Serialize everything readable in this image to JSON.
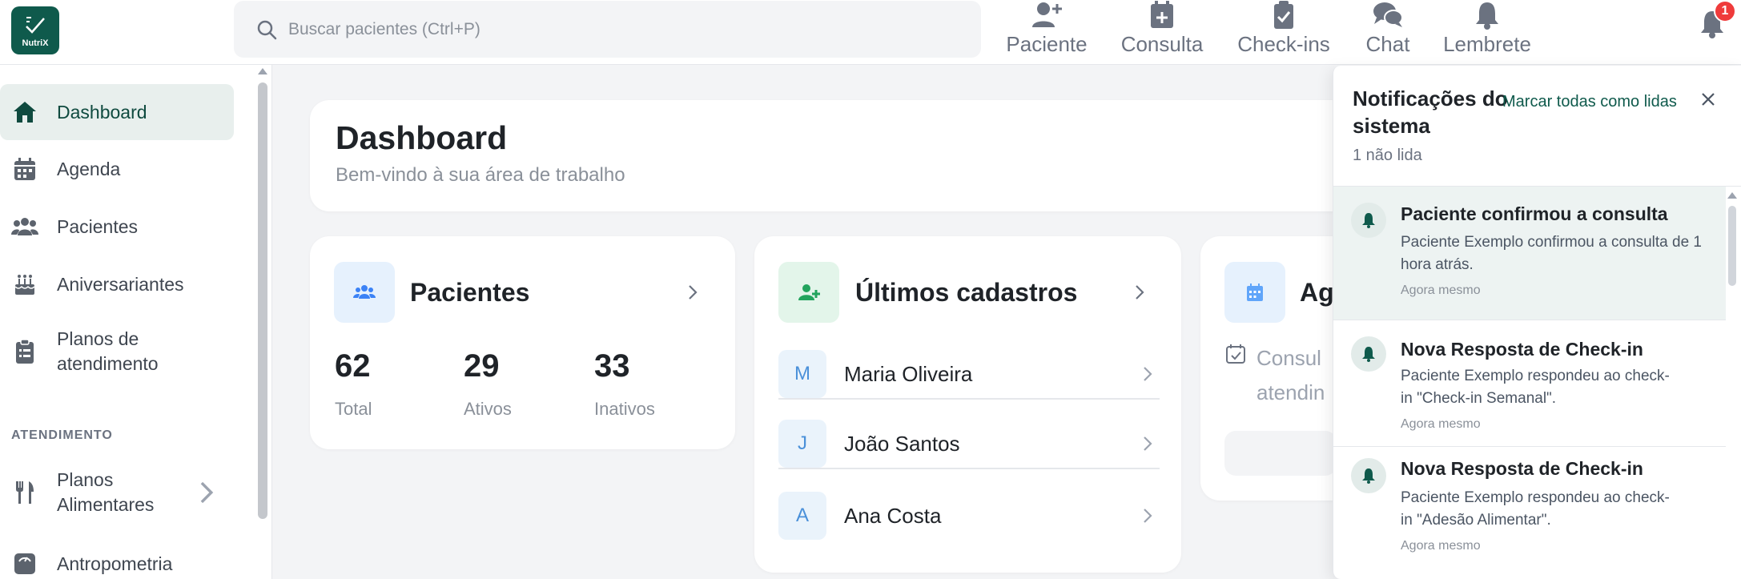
{
  "app": {
    "logo_text": "NutriX"
  },
  "search": {
    "placeholder": "Buscar pacientes (Ctrl+P)"
  },
  "header_actions": [
    {
      "label": "Paciente",
      "icon": "add-user-icon"
    },
    {
      "label": "Consulta",
      "icon": "calendar-plus-icon"
    },
    {
      "label": "Check-ins",
      "icon": "clipboard-check-icon"
    },
    {
      "label": "Chat",
      "icon": "chat-icon"
    },
    {
      "label": "Lembrete",
      "icon": "bell-icon"
    }
  ],
  "notifications_badge": "1",
  "sidebar": {
    "items": [
      {
        "label": "Dashboard",
        "icon": "home-icon",
        "active": true
      },
      {
        "label": "Agenda",
        "icon": "calendar-icon"
      },
      {
        "label": "Pacientes",
        "icon": "users-icon"
      },
      {
        "label": "Aniversariantes",
        "icon": "cake-icon"
      },
      {
        "label": "Planos de atendimento",
        "icon": "clipboard-icon"
      }
    ],
    "section_label": "ATENDIMENTO",
    "section_items": [
      {
        "label": "Planos Alimentares",
        "icon": "utensils-icon",
        "has_submenu": true
      },
      {
        "label": "Antropometria",
        "icon": "scale-icon"
      }
    ]
  },
  "dashboard": {
    "title": "Dashboard",
    "subtitle": "Bem-vindo à sua área de trabalho"
  },
  "patients_card": {
    "title": "Pacientes",
    "stats": [
      {
        "value": "62",
        "label": "Total"
      },
      {
        "value": "29",
        "label": "Ativos"
      },
      {
        "value": "33",
        "label": "Inativos"
      }
    ]
  },
  "recent_card": {
    "title": "Últimos cadastros",
    "people": [
      {
        "initial": "M",
        "name": "Maria Oliveira"
      },
      {
        "initial": "J",
        "name": "João Santos"
      },
      {
        "initial": "A",
        "name": "Ana Costa"
      }
    ]
  },
  "agenda_card": {
    "title": "Ag",
    "line1": "Consul",
    "line2": "atendin"
  },
  "notification_panel": {
    "title": "Notificações do sistema",
    "mark_all": "Marcar todas como lidas",
    "unread_count": "1 não lida",
    "items": [
      {
        "title": "Paciente confirmou a consulta",
        "body": "Paciente Exemplo confirmou a consulta de 1 hora atrás.",
        "time": "Agora mesmo",
        "unread": true
      },
      {
        "title": "Nova Resposta de Check-in",
        "body": "Paciente Exemplo respondeu ao check-in \"Check-in Semanal\".",
        "time": "Agora mesmo",
        "unread": false
      },
      {
        "title": "Nova Resposta de Check-in",
        "body": "Paciente Exemplo respondeu ao check-in \"Adesão Alimentar\".",
        "time": "Agora mesmo",
        "unread": false
      }
    ]
  },
  "colors": {
    "brand": "#0f5a4c",
    "badge": "#ef3b3b",
    "active_bg": "#e8efed",
    "unread_bg": "#edf3f2"
  }
}
